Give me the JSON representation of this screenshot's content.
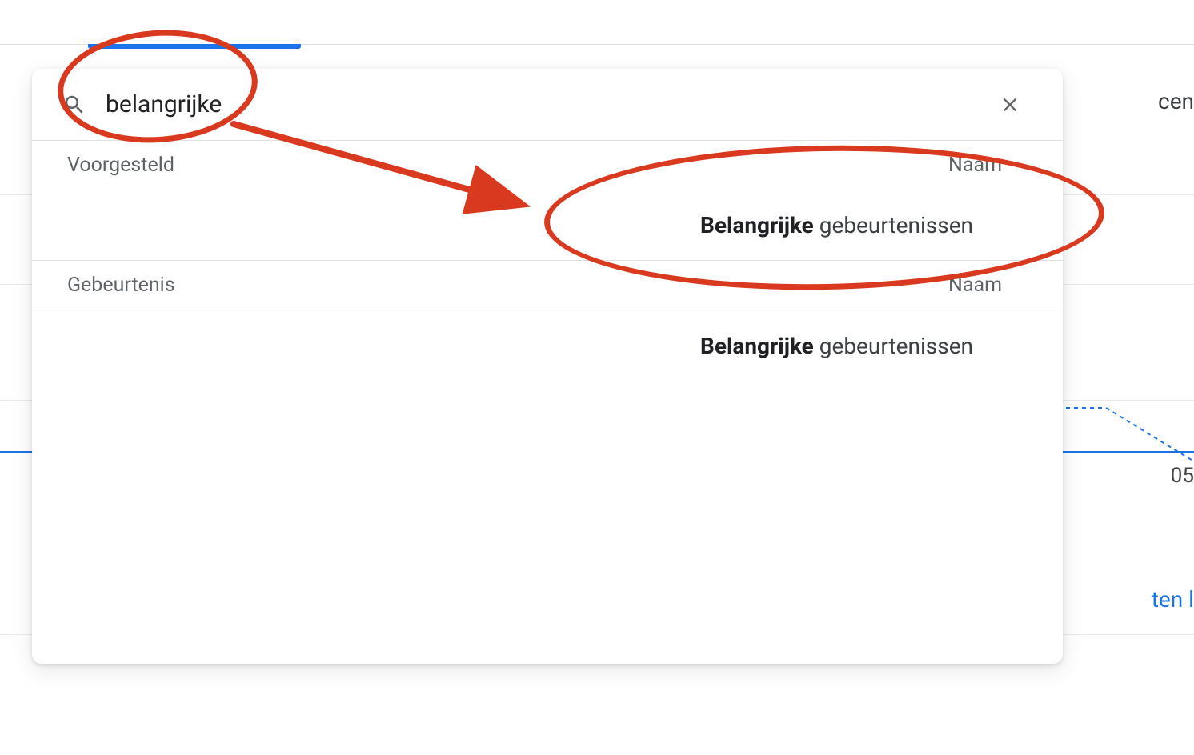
{
  "searchValue": "belangrijke",
  "sections": {
    "suggested": {
      "label": "Voorgesteld",
      "col": "Naam"
    },
    "event": {
      "label": "Gebeurtenis",
      "col": "Naam"
    }
  },
  "results": {
    "suggested": {
      "match": "Belangrijke",
      "rest": " gebeurtenissen"
    },
    "event": {
      "match": "Belangrijke",
      "rest": " gebeurtenissen"
    }
  },
  "bg": {
    "cen": "cen",
    "tick": "05",
    "link_fragment": "ten l"
  }
}
